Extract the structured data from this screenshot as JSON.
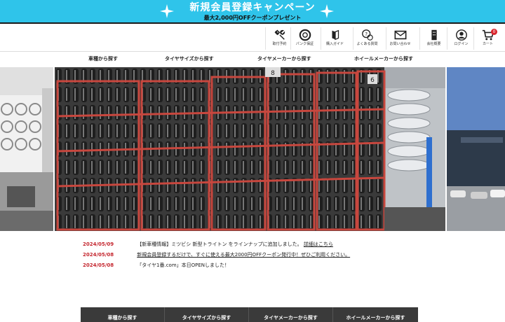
{
  "banner": {
    "title": "新規会員登録キャンペーン",
    "subtitle": "最大2,000円OFFクーポンプレゼント",
    "background_color": "#2fc4ea"
  },
  "header": {
    "icons": [
      {
        "label": "取付予約",
        "icon": "wrench-icon"
      },
      {
        "label": "パンク保証",
        "icon": "tire-icon"
      },
      {
        "label": "購入ガイド",
        "icon": "book-icon"
      },
      {
        "label": "よくある質問",
        "icon": "chat-question-icon"
      },
      {
        "label": "お問い合わせ",
        "icon": "mail-icon"
      },
      {
        "label": "会社概要",
        "icon": "building-icon"
      },
      {
        "label": "ログイン",
        "icon": "user-icon"
      },
      {
        "label": "カート",
        "icon": "cart-icon",
        "badge": "0"
      }
    ]
  },
  "category_nav": {
    "items": [
      "車種から探す",
      "タイヤサイズから探す",
      "タイヤメーカーから探す",
      "ホイールメーカーから探す"
    ]
  },
  "hero": {
    "rack_numbers": [
      "8",
      "6"
    ]
  },
  "news": {
    "accent_color": "#c4262e",
    "items": [
      {
        "date": "2024/05/09",
        "text": "【新車種情報】ミツビシ 新型トライトン をラインナップに追加しました。",
        "link": "詳細はこちら"
      },
      {
        "date": "2024/05/08",
        "text": "新規会員登録するだけで、すぐに使える最大2000円OFFクーポン発行中！ぜひご利用ください。",
        "link": ""
      },
      {
        "date": "2024/05/08",
        "text": "「タイヤ1番.com」本日OPENしました！",
        "link": ""
      }
    ]
  },
  "bottom_nav": {
    "items": [
      "車種から探す",
      "タイヤサイズから探す",
      "タイヤメーカーから探す",
      "ホイールメーカーから探す"
    ]
  }
}
